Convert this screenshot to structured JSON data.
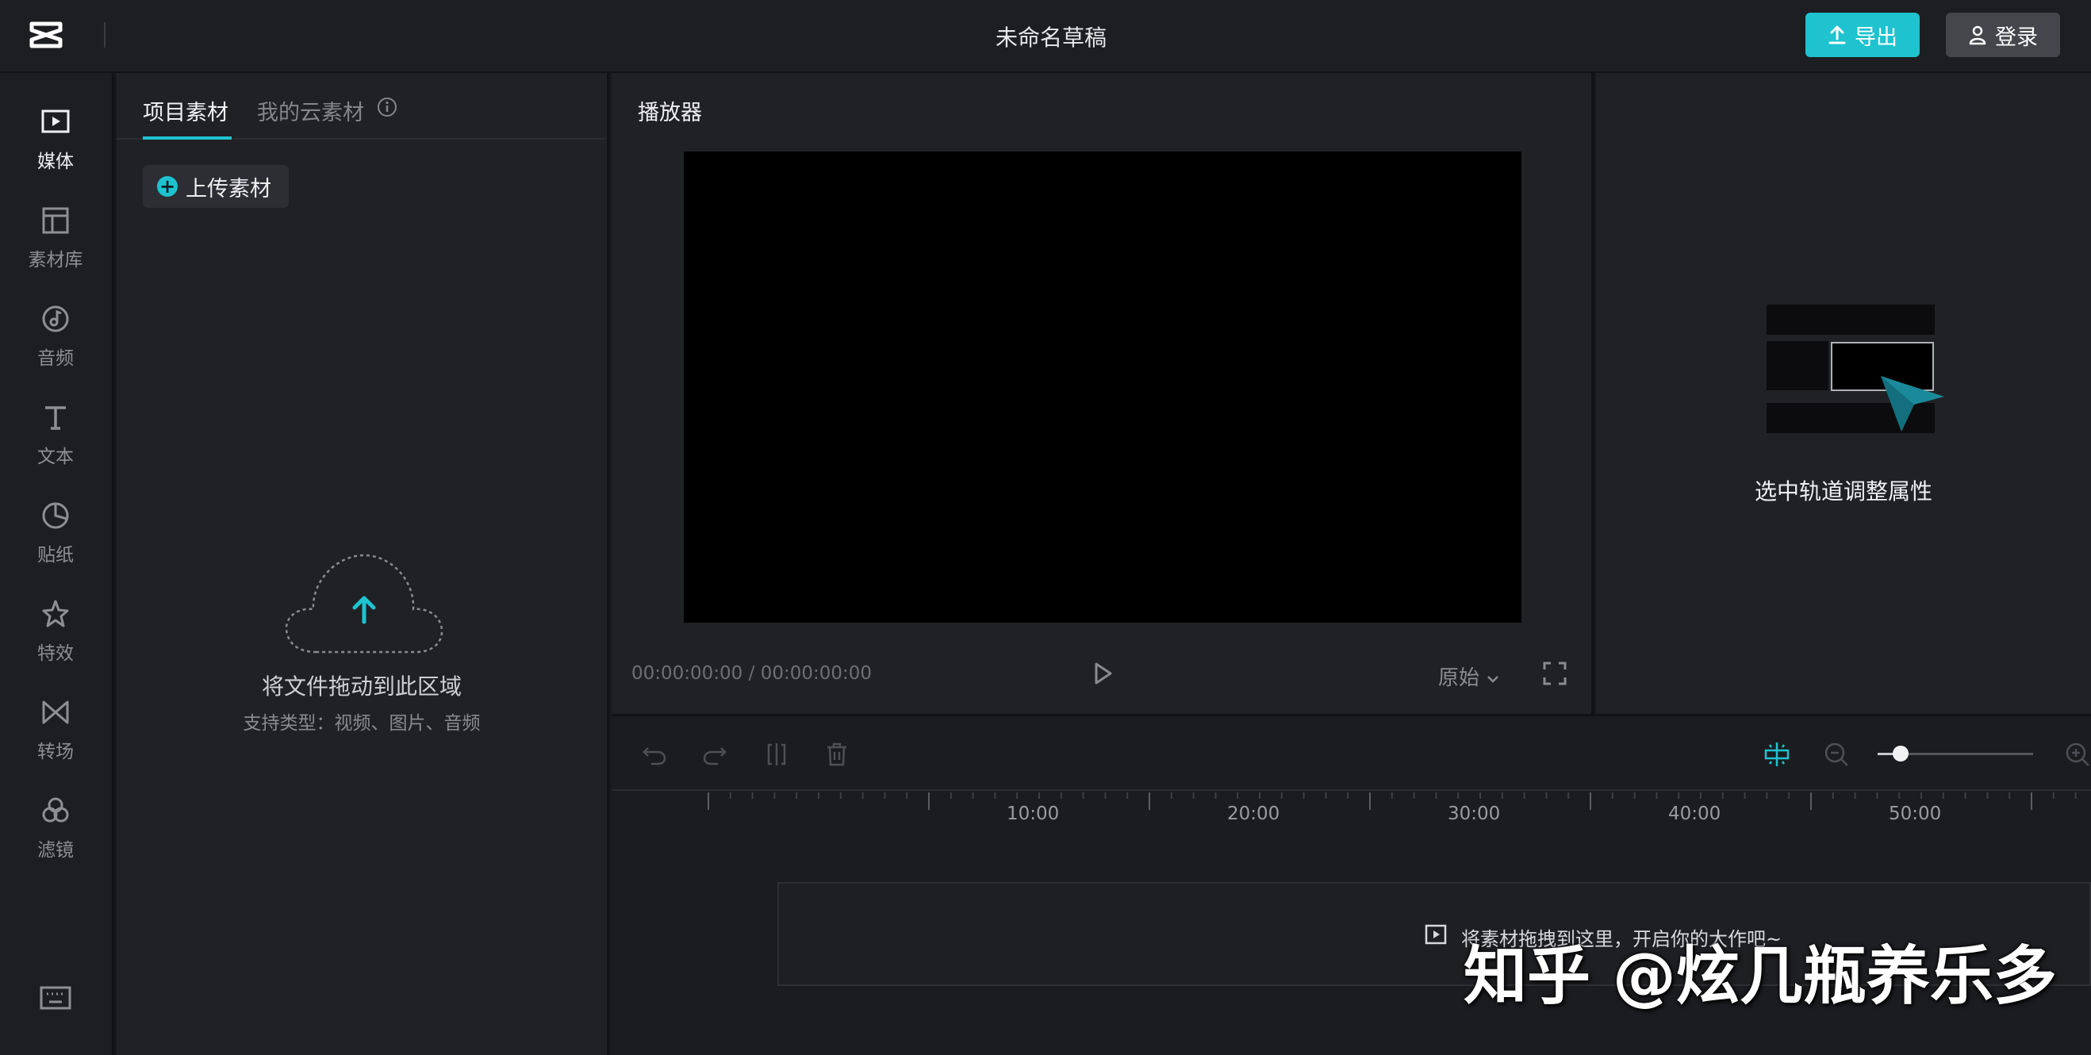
{
  "app": {
    "title": "未命名草稿",
    "export_label": "导出",
    "login_label": "登录",
    "accent_color": "#1ec3cf"
  },
  "sidebar": {
    "items": [
      {
        "label": "媒体",
        "icon": "media-icon",
        "active": true
      },
      {
        "label": "素材库",
        "icon": "library-icon"
      },
      {
        "label": "音频",
        "icon": "audio-icon"
      },
      {
        "label": "文本",
        "icon": "text-icon"
      },
      {
        "label": "贴纸",
        "icon": "sticker-icon"
      },
      {
        "label": "特效",
        "icon": "effects-icon"
      },
      {
        "label": "转场",
        "icon": "transition-icon"
      },
      {
        "label": "滤镜",
        "icon": "filter-icon"
      }
    ],
    "bottom_icon": "keyboard-icon"
  },
  "media_panel": {
    "tabs": [
      "项目素材",
      "我的云素材"
    ],
    "upload_label": "上传素材",
    "drop_title": "将文件拖动到此区域",
    "drop_subtitle": "支持类型：视频、图片、音频"
  },
  "player": {
    "title": "播放器",
    "current_time": "00:00:00:00",
    "separator": "/",
    "total_time": "00:00:00:00",
    "ratio_label": "原始"
  },
  "inspector": {
    "hint": "选中轨道调整属性"
  },
  "timeline": {
    "ruler_labels": [
      "10:00",
      "20:00",
      "30:00",
      "40:00",
      "50:00"
    ],
    "zoom_level": 0.15,
    "drop_hint": "将素材拖拽到这里，开启你的大作吧~"
  },
  "watermark": "知乎 @炫几瓶养乐多"
}
